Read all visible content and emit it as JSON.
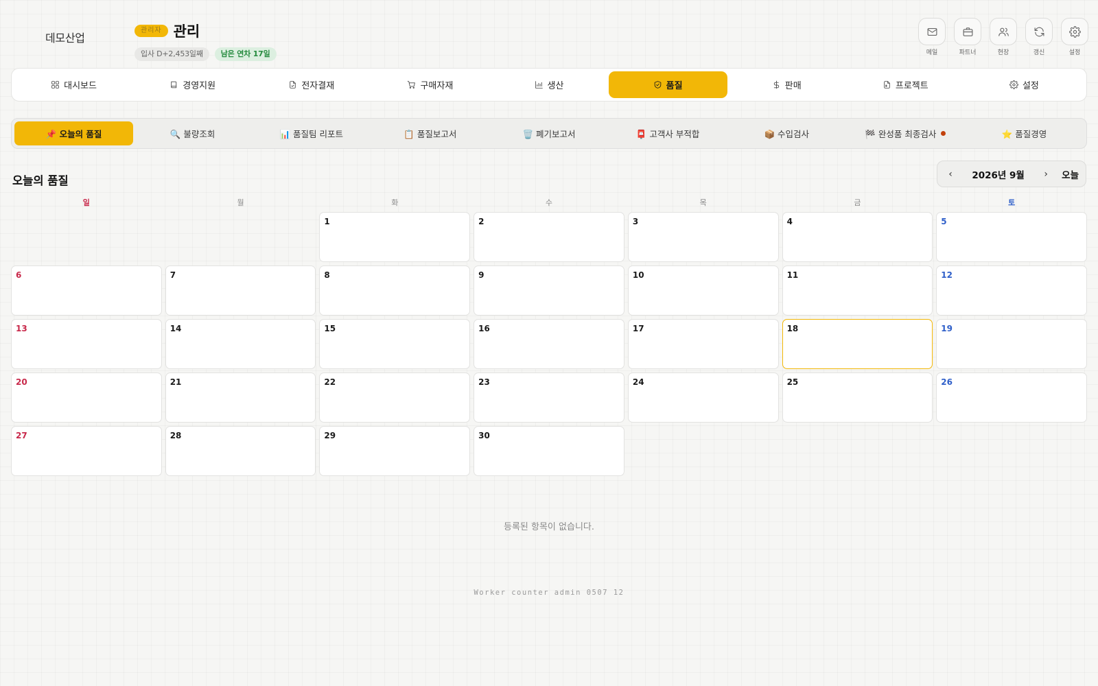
{
  "header": {
    "brand": "데모산업",
    "role_badge": "관리자",
    "page_title": "관리",
    "tenure_badge": "입사 D+2,453일째",
    "leave_badge": "남은 연차 17일"
  },
  "top_icons": [
    {
      "label": "메일",
      "icon": "mail-icon"
    },
    {
      "label": "파트너",
      "icon": "briefcase-icon"
    },
    {
      "label": "현장",
      "icon": "users-icon"
    },
    {
      "label": "갱신",
      "icon": "refresh-icon"
    },
    {
      "label": "설정",
      "icon": "gear-icon"
    }
  ],
  "main_nav": [
    {
      "label": "대시보드",
      "icon": "grid-icon"
    },
    {
      "label": "경영지원",
      "icon": "book-icon"
    },
    {
      "label": "전자결재",
      "icon": "file-sign-icon"
    },
    {
      "label": "구매자재",
      "icon": "cart-icon"
    },
    {
      "label": "생산",
      "icon": "chart-icon"
    },
    {
      "label": "품질",
      "icon": "shield-check-icon",
      "active": true
    },
    {
      "label": "판매",
      "icon": "dollar-icon"
    },
    {
      "label": "프로젝트",
      "icon": "file-project-icon"
    },
    {
      "label": "설정",
      "icon": "gear-icon"
    }
  ],
  "sub_tabs": [
    {
      "label": "📌 오늘의 품질",
      "active": true
    },
    {
      "label": "🔍 불량조회"
    },
    {
      "label": "📊 품질팀 리포트"
    },
    {
      "label": "📋 품질보고서"
    },
    {
      "label": "🗑️ 폐기보고서"
    },
    {
      "label": "📮 고객사 부적합"
    },
    {
      "label": "📦 수입검사"
    },
    {
      "label": "🏁 완성품 최종검사",
      "has_dot": true
    },
    {
      "label": "⭐ 품질경영"
    }
  ],
  "section": {
    "title": "오늘의 품질",
    "month_label": "2026년 9월",
    "prev_arrow": "‹",
    "next_arrow": "›",
    "today_button": "오늘"
  },
  "calendar": {
    "weekdays": [
      "일",
      "월",
      "화",
      "수",
      "목",
      "금",
      "토"
    ],
    "first_weekday_index": 2,
    "days_in_month": 30,
    "today": 18
  },
  "empty_message": "등록된 항목이 없습니다.",
  "footer": "Worker counter admin 0507 12",
  "colors": {
    "accent": "#f2b707",
    "sunday": "#c8284a",
    "saturday": "#2f5fc9",
    "dot": "#c2410c"
  }
}
